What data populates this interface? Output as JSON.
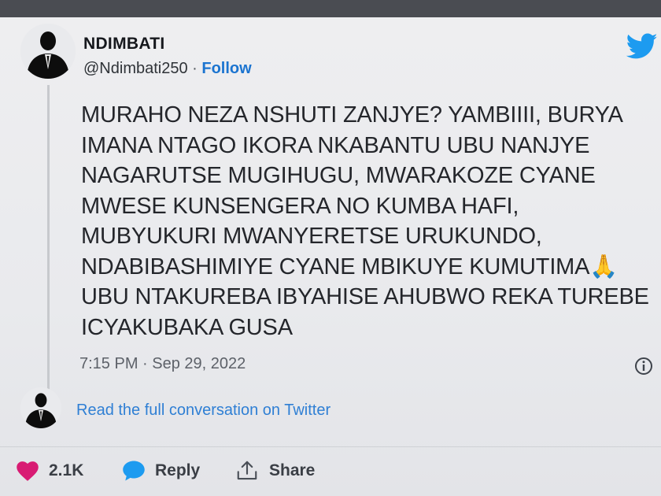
{
  "author": {
    "display_name": "NDIMBATI",
    "handle": "@Ndimbati250",
    "separator": " · ",
    "follow_label": "Follow"
  },
  "tweet": {
    "lines": [
      "MURAHO NEZA NSHUTI ZANJYE? YAMBIIII, BURYA",
      "IMANA NTAGO IKORA NKABANTU  UBU NANJYE",
      "NAGARUTSE MUGIHUGU, MWARAKOZE CYANE",
      "MWESE KUNSENGERA NO KUMBA HAFI,",
      "MUBYUKURI MWANYERETSE URUKUNDO,",
      "NDABIBASHIMIYE CYANE MBIKUYE KUMUTIMA🙏",
      "UBU NTAKUREBA IBYAHISE AHUBWO REKA TUREBE",
      "ICYAKUBAKA GUSA"
    ],
    "timestamp": "7:15 PM · Sep 29, 2022"
  },
  "conversation_link": "Read the full conversation on Twitter",
  "actions": {
    "like_count": "2.1K",
    "reply_label": "Reply",
    "share_label": "Share"
  },
  "icons": {
    "logo": "twitter-bird-icon",
    "info": "info-icon",
    "like": "heart-icon",
    "reply": "speech-bubble-icon",
    "share": "share-arrow-icon"
  },
  "colors": {
    "twitter_blue": "#1d9bf0",
    "link_blue": "#1b74d0",
    "heart": "#d81b73",
    "background": "#e9eaed"
  }
}
